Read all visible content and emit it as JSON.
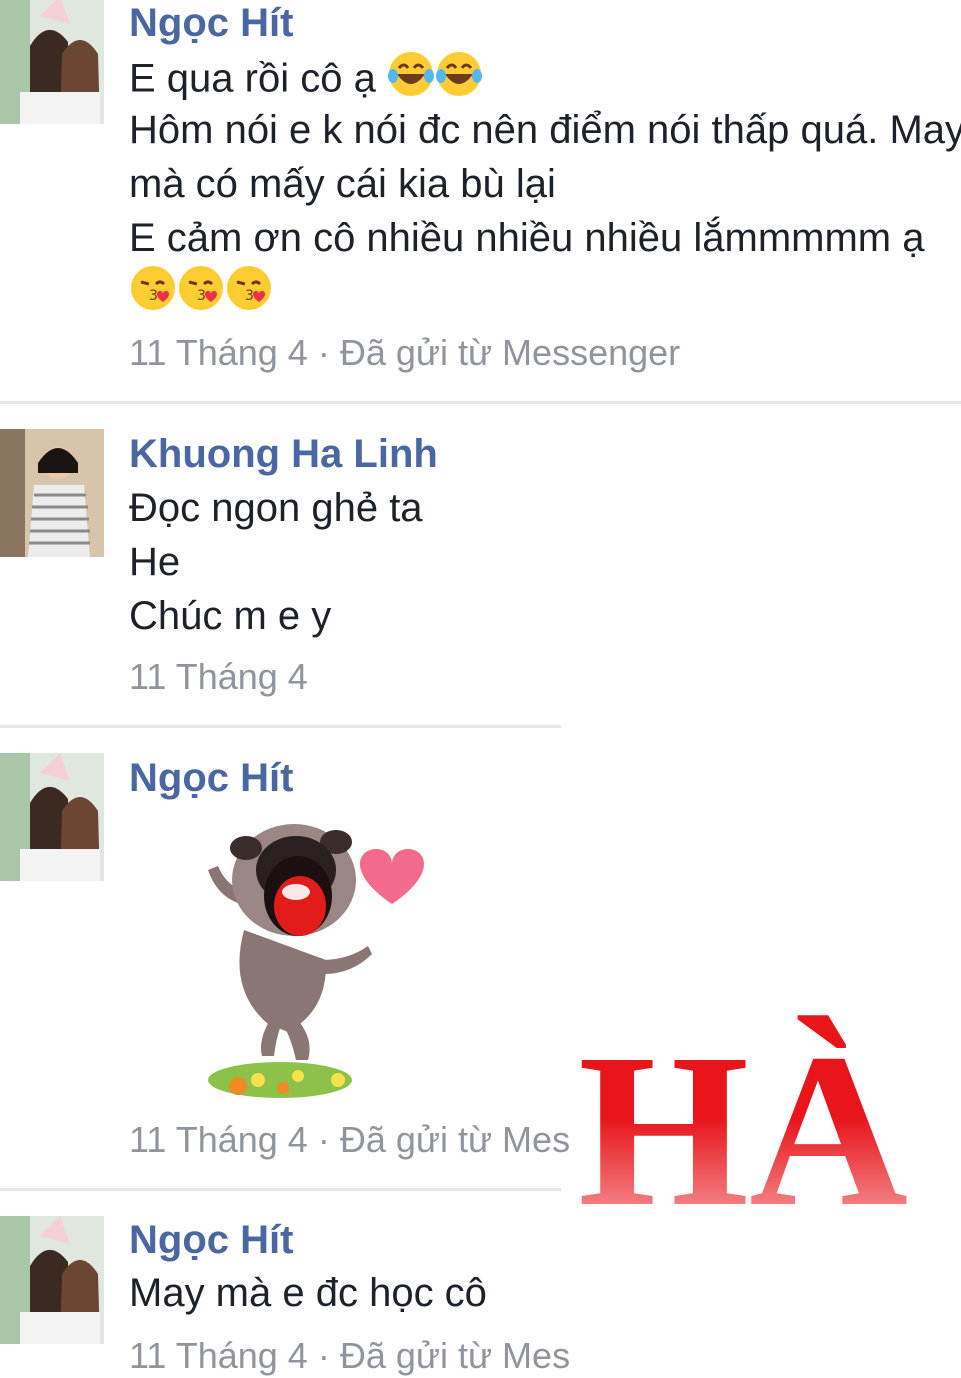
{
  "messages": [
    {
      "sender": "Ngọc Hít",
      "lines": [
        "E qua rồi cô ạ",
        "Hôm nói e k nói đc nên điểm nói thấp quá. May",
        "mà có mấy cái kia bù lại",
        "E cảm ơn cô nhiều nhiều nhiều lắmmmmm ạ"
      ],
      "emojis_line1": [
        "laughing-tears",
        "laughing-tears"
      ],
      "emojis_line5": [
        "kissing-heart",
        "kissing-heart",
        "kissing-heart"
      ],
      "meta": "11 Tháng 4 · Đã gửi từ Messenger"
    },
    {
      "sender": "Khuong Ha Linh",
      "lines": [
        "Đọc ngon ghẻ ta",
        "He",
        "Chúc m e y"
      ],
      "meta": "11 Tháng 4"
    },
    {
      "sender": "Ngọc Hít",
      "sticker": "pug-love-sticker",
      "meta": "11 Tháng 4 · Đã gửi từ Mes"
    },
    {
      "sender": "Ngọc Hít",
      "lines": [
        "May mà e đc học cô"
      ],
      "meta": "11 Tháng 4 · Đã gửi từ Mes"
    }
  ],
  "watermark": {
    "text": "HÀ",
    "color": "#e8151b"
  },
  "colors": {
    "name": "#4b67a1",
    "text": "#1d2129",
    "meta": "#90949c",
    "divider": "#e4e6eb"
  }
}
